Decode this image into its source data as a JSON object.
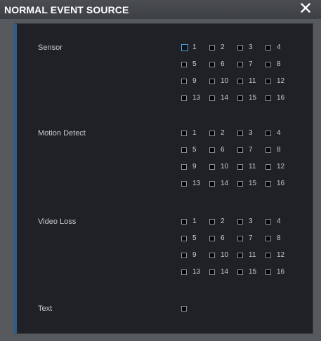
{
  "dialog": {
    "title": "NORMAL EVENT SOURCE",
    "close_icon": "close-icon"
  },
  "sections": [
    {
      "key": "sensor",
      "label": "Sensor",
      "rows": [
        [
          "1",
          "2",
          "3",
          "4"
        ],
        [
          "5",
          "6",
          "7",
          "8"
        ],
        [
          "9",
          "10",
          "11",
          "12"
        ],
        [
          "13",
          "14",
          "15",
          "16"
        ]
      ],
      "checked": [],
      "focused": "1"
    },
    {
      "key": "motion-detect",
      "label": "Motion Detect",
      "rows": [
        [
          "1",
          "2",
          "3",
          "4"
        ],
        [
          "5",
          "6",
          "7",
          "8"
        ],
        [
          "9",
          "10",
          "11",
          "12"
        ],
        [
          "13",
          "14",
          "15",
          "16"
        ]
      ],
      "checked": []
    },
    {
      "key": "video-loss",
      "label": "Video Loss",
      "rows": [
        [
          "1",
          "2",
          "3",
          "4"
        ],
        [
          "5",
          "6",
          "7",
          "8"
        ],
        [
          "9",
          "10",
          "11",
          "12"
        ],
        [
          "13",
          "14",
          "15",
          "16"
        ]
      ],
      "checked": []
    },
    {
      "key": "text",
      "label": "Text",
      "rows": [
        [
          ""
        ]
      ],
      "checked": []
    }
  ],
  "colors": {
    "title_bar": "#3c3f43",
    "panel": "#1f2126",
    "accent_border": "#2e5f8a",
    "focus": "#4aa3df",
    "label": "#c9ccd1"
  }
}
